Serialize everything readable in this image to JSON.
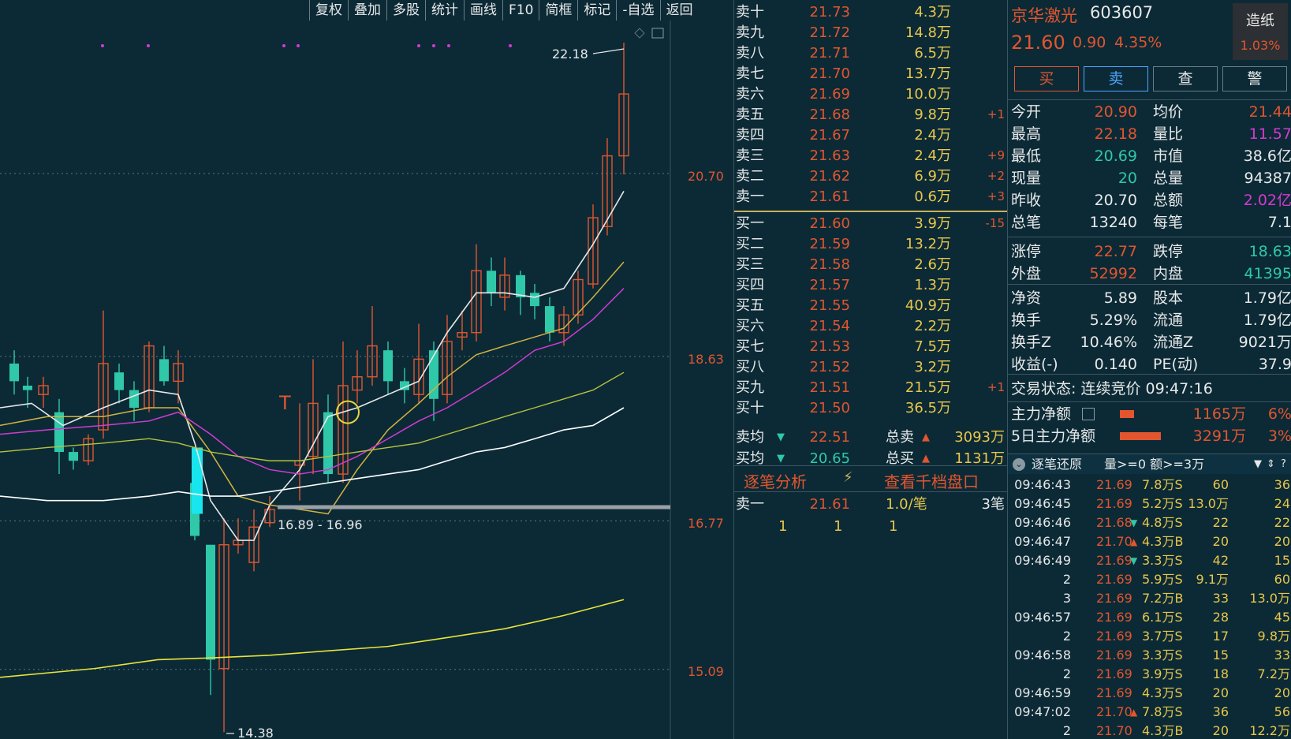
{
  "toolbar": {
    "items": [
      "复权",
      "叠加",
      "多股",
      "统计",
      "画线",
      "F10",
      "简框",
      "标记",
      "-自选",
      "返回"
    ]
  },
  "chart": {
    "price_levels": [
      "20.70",
      "18.63",
      "16.77",
      "15.09"
    ],
    "high_note": "22.18",
    "low_note": "14.38",
    "range_note": "16.89 - 16.96",
    "t_marker": "T"
  },
  "orderbook": {
    "asks": [
      {
        "name": "卖十",
        "price": "21.73",
        "vol": "4.3万",
        "chg": ""
      },
      {
        "name": "卖九",
        "price": "21.72",
        "vol": "14.8万",
        "chg": ""
      },
      {
        "name": "卖八",
        "price": "21.71",
        "vol": "6.5万",
        "chg": ""
      },
      {
        "name": "卖七",
        "price": "21.70",
        "vol": "13.7万",
        "chg": ""
      },
      {
        "name": "卖六",
        "price": "21.69",
        "vol": "10.0万",
        "chg": ""
      },
      {
        "name": "卖五",
        "price": "21.68",
        "vol": "9.8万",
        "chg": "+1"
      },
      {
        "name": "卖四",
        "price": "21.67",
        "vol": "2.4万",
        "chg": ""
      },
      {
        "name": "卖三",
        "price": "21.63",
        "vol": "2.4万",
        "chg": "+9"
      },
      {
        "name": "卖二",
        "price": "21.62",
        "vol": "6.9万",
        "chg": "+2"
      },
      {
        "name": "卖一",
        "price": "21.61",
        "vol": "0.6万",
        "chg": "+3"
      }
    ],
    "bids": [
      {
        "name": "买一",
        "price": "21.60",
        "vol": "3.9万",
        "chg": "-15"
      },
      {
        "name": "买二",
        "price": "21.59",
        "vol": "13.2万",
        "chg": ""
      },
      {
        "name": "买三",
        "price": "21.58",
        "vol": "2.6万",
        "chg": ""
      },
      {
        "name": "买四",
        "price": "21.57",
        "vol": "1.3万",
        "chg": ""
      },
      {
        "name": "买五",
        "price": "21.55",
        "vol": "40.9万",
        "chg": ""
      },
      {
        "name": "买六",
        "price": "21.54",
        "vol": "2.2万",
        "chg": ""
      },
      {
        "name": "买七",
        "price": "21.53",
        "vol": "7.5万",
        "chg": ""
      },
      {
        "name": "买八",
        "price": "21.52",
        "vol": "3.2万",
        "chg": ""
      },
      {
        "name": "买九",
        "price": "21.51",
        "vol": "21.5万",
        "chg": "+1"
      },
      {
        "name": "买十",
        "price": "21.50",
        "vol": "36.5万",
        "chg": ""
      }
    ],
    "ask_avg_label": "卖均",
    "ask_avg": "22.51",
    "bid_avg_label": "买均",
    "bid_avg": "20.65",
    "total_sell_label": "总卖",
    "total_sell": "3093万",
    "total_buy_label": "总买",
    "total_buy": "1131万",
    "tab_analysis": "逐笔分析",
    "tab_depth": "查看千档盘口",
    "detail_name": "卖一",
    "detail_price": "21.61",
    "detail_per": "1.0/笔",
    "detail_count": "3笔",
    "detail_qty": [
      "1",
      "1",
      "1"
    ]
  },
  "stock": {
    "name": "京华激光",
    "code": "603607",
    "price": "21.60",
    "change": "0.90",
    "pct": "4.35%",
    "sector": "造纸",
    "sector_pct": "1.03%"
  },
  "buttons": {
    "buy": "买",
    "sell": "卖",
    "query": "查",
    "alert": "警"
  },
  "quote": [
    {
      "l1": "今开",
      "v1": "20.90",
      "c1": "red",
      "l2": "均价",
      "v2": "21.44",
      "c2": "red"
    },
    {
      "l1": "最高",
      "v1": "22.18",
      "c1": "red",
      "l2": "量比",
      "v2": "11.57",
      "c2": "magenta"
    },
    {
      "l1": "最低",
      "v1": "20.69",
      "c1": "green",
      "l2": "市值",
      "v2": "38.6亿",
      "c2": "white"
    },
    {
      "l1": "现量",
      "v1": "20",
      "c1": "green",
      "l2": "总量",
      "v2": "94387",
      "c2": "white"
    },
    {
      "l1": "昨收",
      "v1": "20.70",
      "c1": "white",
      "l2": "总额",
      "v2": "2.02亿",
      "c2": "magenta"
    },
    {
      "l1": "总笔",
      "v1": "13240",
      "c1": "white",
      "l2": "每笔",
      "v2": "7.1",
      "c2": "white"
    },
    {
      "l1": "涨停",
      "v1": "22.77",
      "c1": "red",
      "l2": "跌停",
      "v2": "18.63",
      "c2": "green"
    },
    {
      "l1": "外盘",
      "v1": "52992",
      "c1": "red",
      "l2": "内盘",
      "v2": "41395",
      "c2": "green"
    },
    {
      "l1": "净资",
      "v1": "5.89",
      "c1": "white",
      "l2": "股本",
      "v2": "1.79亿",
      "c2": "white"
    },
    {
      "l1": "换手",
      "v1": "5.29%",
      "c1": "white",
      "l2": "流通",
      "v2": "1.79亿",
      "c2": "white"
    },
    {
      "l1": "换手Z",
      "v1": "10.46%",
      "c1": "white",
      "l2": "流通Z",
      "v2": "9021万",
      "c2": "white"
    },
    {
      "l1": "收益(-)",
      "v1": "0.140",
      "c1": "white",
      "l2": "PE(动)",
      "v2": "37.9",
      "c2": "white"
    }
  ],
  "trade_status": "交易状态: 连续竞价 09:47:16",
  "main_flow_label": "主力净额",
  "main_flow": "1165万",
  "main_flow_pct": "6%",
  "main_flow5_label": "5日主力净额",
  "main_flow5": "3291万",
  "main_flow5_pct": "3%",
  "ticks_header": {
    "title": "逐笔还原",
    "filter": "量>=0 额>=3万"
  },
  "ticks": [
    {
      "time": "09:46:43",
      "price": "21.69",
      "arrow": "",
      "vol": "7.8万S",
      "n1": "60",
      "n2": "36"
    },
    {
      "time": "09:46:45",
      "price": "21.69",
      "arrow": "",
      "vol": "5.2万S",
      "n1": "13.0万",
      "n2": "24"
    },
    {
      "time": "09:46:46",
      "price": "21.68",
      "arrow": "down",
      "vol": "4.8万S",
      "n1": "22",
      "n2": "22"
    },
    {
      "time": "09:46:47",
      "price": "21.70",
      "arrow": "up",
      "vol": "4.3万B",
      "n1": "20",
      "n2": "20"
    },
    {
      "time": "09:46:49",
      "price": "21.69",
      "arrow": "down",
      "vol": "3.3万S",
      "n1": "42",
      "n2": "15"
    },
    {
      "time": "2",
      "price": "21.69",
      "arrow": "",
      "vol": "5.9万S",
      "n1": "9.1万",
      "n2": "60"
    },
    {
      "time": "3",
      "price": "21.69",
      "arrow": "",
      "vol": "7.2万B",
      "n1": "33",
      "n2": "13.0万"
    },
    {
      "time": "09:46:57",
      "price": "21.69",
      "arrow": "",
      "vol": "6.1万S",
      "n1": "28",
      "n2": "45"
    },
    {
      "time": "2",
      "price": "21.69",
      "arrow": "",
      "vol": "3.7万S",
      "n1": "17",
      "n2": "9.8万"
    },
    {
      "time": "09:46:58",
      "price": "21.69",
      "arrow": "",
      "vol": "3.3万S",
      "n1": "15",
      "n2": "33"
    },
    {
      "time": "2",
      "price": "21.69",
      "arrow": "",
      "vol": "3.9万S",
      "n1": "18",
      "n2": "7.2万"
    },
    {
      "time": "09:46:59",
      "price": "21.69",
      "arrow": "",
      "vol": "4.3万S",
      "n1": "20",
      "n2": "20"
    },
    {
      "time": "09:47:02",
      "price": "21.70",
      "arrow": "up",
      "vol": "7.8万S",
      "n1": "36",
      "n2": "56"
    },
    {
      "time": "2",
      "price": "21.70",
      "arrow": "",
      "vol": "4.3万B",
      "n1": "20",
      "n2": "12.2万"
    }
  ],
  "colors": {
    "up": "#e2552f",
    "down": "#2fc8a8",
    "background": "#0b2a36",
    "volume": "#e9c64a"
  }
}
